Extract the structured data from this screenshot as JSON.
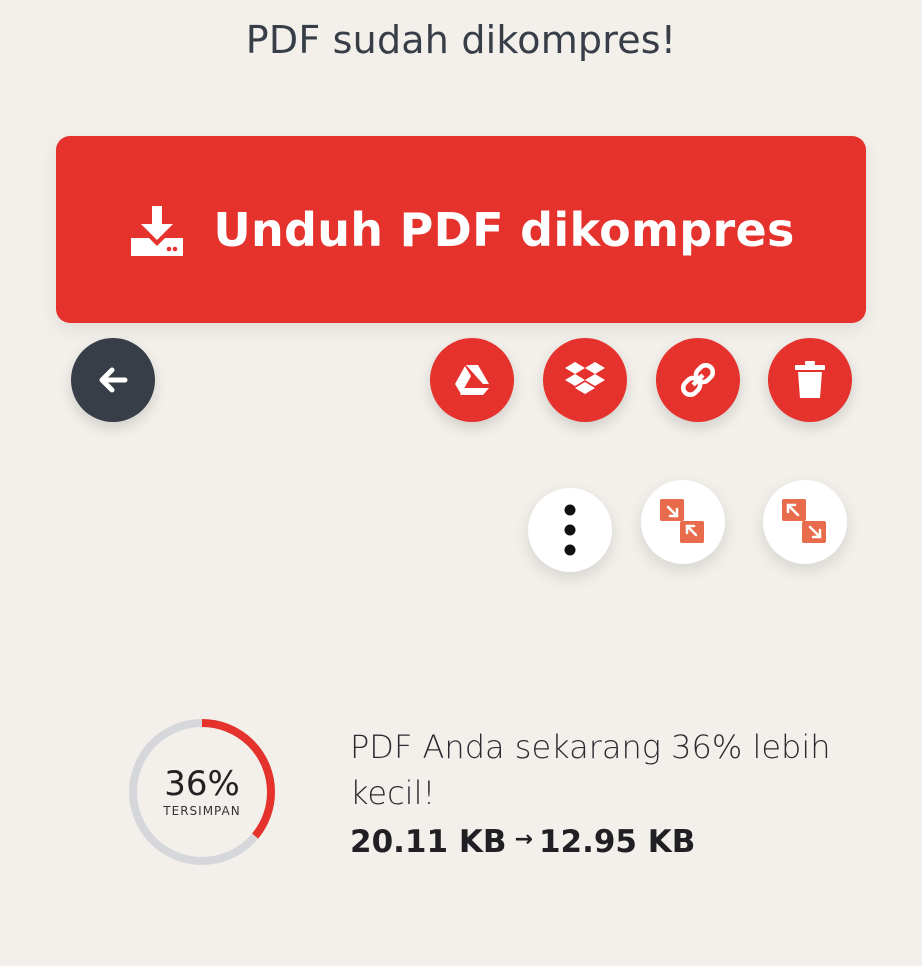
{
  "header": {
    "title": "PDF sudah dikompres!"
  },
  "download": {
    "label": "Unduh PDF dikompres",
    "icon": "download-icon"
  },
  "actions": {
    "back": {
      "icon": "arrow-left-icon"
    },
    "google_drive": {
      "icon": "google-drive-icon"
    },
    "dropbox": {
      "icon": "dropbox-icon"
    },
    "link": {
      "icon": "link-icon"
    },
    "delete": {
      "icon": "trash-icon"
    },
    "more": {
      "icon": "more-vertical-icon"
    },
    "compress_again": {
      "icon": "compress-icon"
    },
    "expand": {
      "icon": "expand-icon"
    }
  },
  "result": {
    "percent_label": "36%",
    "percent_value": 36,
    "caption": "TERSIMPAN",
    "message": "PDF Anda sekarang 36% lebih kecil!",
    "original_size": "20.11 KB",
    "arrow": "→",
    "new_size": "12.95 KB"
  },
  "colors": {
    "accent": "#e5322d",
    "dark": "#383e47",
    "background": "#f3f0eb",
    "ring_track": "#d6d7da",
    "secondary_icon": "#e86b4b"
  }
}
